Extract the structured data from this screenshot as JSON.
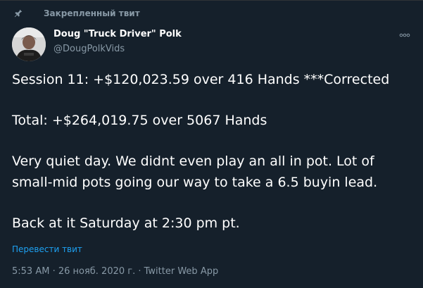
{
  "pinned": {
    "label": "Закрепленный твит",
    "icon": "pin-icon"
  },
  "author": {
    "name": "Doug \"Truck Driver\" Polk",
    "handle": "@DougPolkVids",
    "avatar_icon": "avatar-photo"
  },
  "more_icon": "more-options-icon",
  "tweet": {
    "line1": "Session 11: +$120,023.59 over 416 Hands ***Corrected",
    "line2": "Total: +$264,019.75 over 5067 Hands",
    "line3a": "Very quiet day. We didnt even play an all in pot. Lot of",
    "line3b": "small-mid pots going our way to take a 6.5 buyin lead.",
    "line4": "Back at it Saturday at 2:30 pm pt."
  },
  "translate_label": "Перевести твит",
  "meta": {
    "text": "5:53 AM · 26 нояб. 2020 г. · Twitter Web App"
  },
  "colors": {
    "background": "#15202b",
    "secondary_text": "#8899a6",
    "link": "#1da1f2"
  }
}
